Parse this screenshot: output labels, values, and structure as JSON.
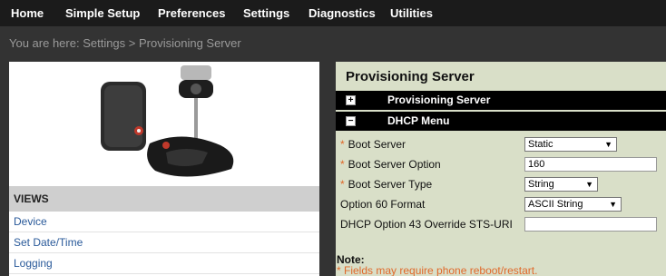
{
  "nav": {
    "items": [
      "Home",
      "Simple Setup",
      "Preferences",
      "Settings",
      "Diagnostics",
      "Utilities"
    ]
  },
  "breadcrumb": "You are here: Settings > Provisioning Server",
  "views": {
    "header": "VIEWS",
    "items": [
      "Device",
      "Set Date/Time",
      "Logging"
    ]
  },
  "panel": {
    "title": "Provisioning Server",
    "sections": [
      {
        "toggle": "+",
        "label": "Provisioning Server"
      },
      {
        "toggle": "−",
        "label": "DHCP Menu"
      }
    ],
    "required_mark": "*",
    "fields": {
      "boot_server": {
        "label": "Boot Server",
        "value": "Static"
      },
      "boot_server_option": {
        "label": "Boot Server Option",
        "value": "160"
      },
      "boot_server_type": {
        "label": "Boot Server Type",
        "value": "String"
      },
      "option60_format": {
        "label": "Option 60 Format",
        "value": "ASCII String"
      },
      "dhcp_option43": {
        "label": "DHCP Option 43 Override STS-URI",
        "value": ""
      }
    },
    "note_title": "Note:",
    "note_text": "* Fields may require phone reboot/restart."
  },
  "colors": {
    "nav_bg": "#1b1b1b",
    "page_bg": "#333333",
    "panel_bg": "#d9dfc8",
    "required": "#e0692a",
    "link": "#2a5a9a"
  }
}
